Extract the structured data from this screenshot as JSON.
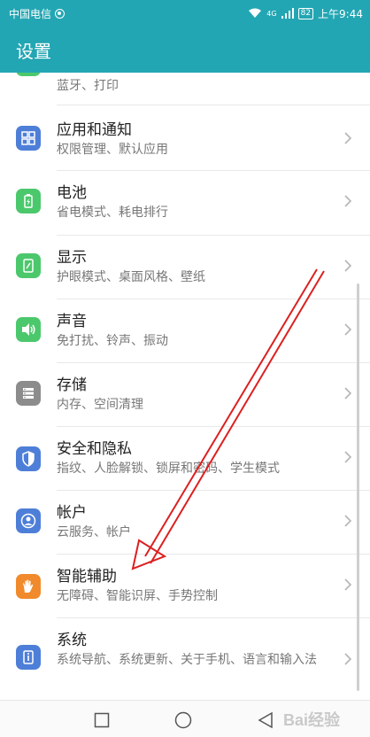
{
  "status_bar": {
    "carrier": "中国电信",
    "network": "4G",
    "battery": "82",
    "time": "上午9:44"
  },
  "header": {
    "title": "设置"
  },
  "items": [
    {
      "key": "bluetooth",
      "title": "",
      "subtitle": "蓝牙、打印",
      "icon": "bluetooth-device-icon",
      "color": "#4cc86c"
    },
    {
      "key": "apps",
      "title": "应用和通知",
      "subtitle": "权限管理、默认应用",
      "icon": "apps-grid-icon",
      "color": "#4e7fd8"
    },
    {
      "key": "battery",
      "title": "电池",
      "subtitle": "省电模式、耗电排行",
      "icon": "battery-icon",
      "color": "#4cc86c"
    },
    {
      "key": "display",
      "title": "显示",
      "subtitle": "护眼模式、桌面风格、壁纸",
      "icon": "display-icon",
      "color": "#4cc86c"
    },
    {
      "key": "sound",
      "title": "声音",
      "subtitle": "免打扰、铃声、振动",
      "icon": "speaker-icon",
      "color": "#4cc86c"
    },
    {
      "key": "storage",
      "title": "存储",
      "subtitle": "内存、空间清理",
      "icon": "storage-icon",
      "color": "#8c8c8c"
    },
    {
      "key": "security",
      "title": "安全和隐私",
      "subtitle": "指纹、人脸解锁、锁屏和密码、学生模式",
      "icon": "shield-icon",
      "color": "#4e7fd8"
    },
    {
      "key": "account",
      "title": "帐户",
      "subtitle": "云服务、帐户",
      "icon": "account-icon",
      "color": "#4e7fd8"
    },
    {
      "key": "accessibility",
      "title": "智能辅助",
      "subtitle": "无障碍、智能识屏、手势控制",
      "icon": "hand-icon",
      "color": "#f08a2c"
    },
    {
      "key": "system",
      "title": "系统",
      "subtitle": "系统导航、系统更新、关于手机、语言和输入法",
      "icon": "system-info-icon",
      "color": "#4e7fd8"
    }
  ],
  "watermark": "Bai经验"
}
